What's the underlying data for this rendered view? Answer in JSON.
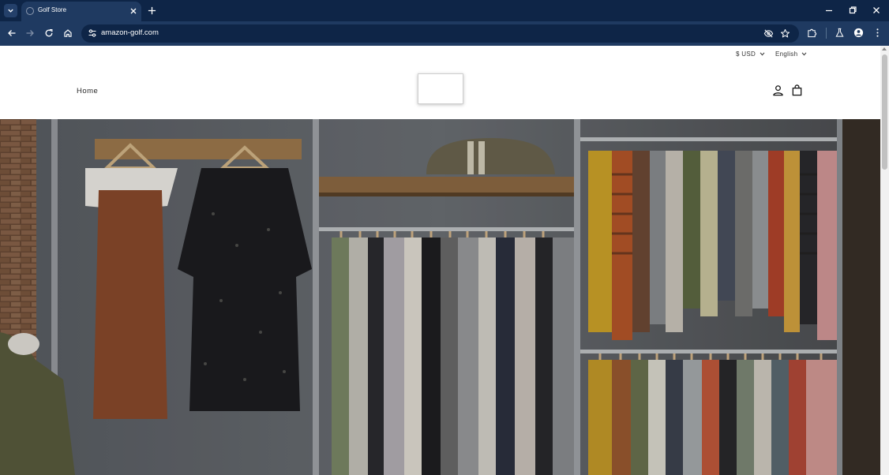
{
  "browser": {
    "tab_title": "Golf Store",
    "url": "amazon-golf.com",
    "icons": {
      "tab_search": "chevron-down-icon",
      "favicon": "globe-icon",
      "tab_close": "close-icon",
      "new_tab": "plus-icon",
      "minimize": "minimize-icon",
      "restore": "restore-icon",
      "close": "close-icon",
      "back": "back-arrow-icon",
      "forward": "forward-arrow-icon",
      "reload": "reload-icon",
      "home": "home-icon",
      "site_info": "tune-icon",
      "hide": "eye-off-icon",
      "bookmark": "star-icon",
      "extensions": "puzzle-icon",
      "labs": "flask-icon",
      "profile": "account-icon",
      "menu": "kebab-menu-icon"
    }
  },
  "store": {
    "currency": "$ USD",
    "language": "English",
    "nav": {
      "home": "Home"
    },
    "icons": {
      "account": "user-icon",
      "cart": "shopping-bag-icon",
      "caret": "chevron-down-icon"
    },
    "hero": {
      "subject": "clothing-racks-photo"
    }
  }
}
